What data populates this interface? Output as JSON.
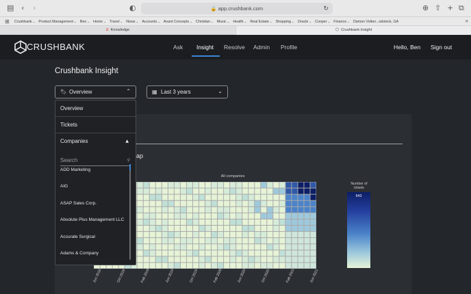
{
  "browser": {
    "url": "app.crushbank.com",
    "favorites": [
      {
        "label": "Crushbank",
        "dropdown": true
      },
      {
        "label": "Product Management",
        "dropdown": true
      },
      {
        "label": "Ben",
        "dropdown": true
      },
      {
        "label": "Home",
        "dropdown": true
      },
      {
        "label": "Travel",
        "dropdown": true
      },
      {
        "label": "News",
        "dropdown": true
      },
      {
        "label": "Accounts",
        "dropdown": true
      },
      {
        "label": "Avant Concepts",
        "dropdown": true
      },
      {
        "label": "Christian",
        "dropdown": true
      },
      {
        "label": "Music",
        "dropdown": true
      },
      {
        "label": "Health",
        "dropdown": true
      },
      {
        "label": "Real Estate",
        "dropdown": true
      },
      {
        "label": "Shopping",
        "dropdown": true
      },
      {
        "label": "Oracle",
        "dropdown": true
      },
      {
        "label": "Cooper",
        "dropdown": true
      },
      {
        "label": "Finance",
        "dropdown": true
      },
      {
        "label": "Damon Volker...odstock, GA",
        "dropdown": false
      }
    ],
    "tabs": [
      {
        "label": "Knowledge",
        "active": false
      },
      {
        "label": "Crushbank Insight",
        "active": true
      }
    ]
  },
  "app": {
    "logo_text": "CRUSHBANK",
    "nav": [
      "Ask",
      "Insight",
      "Resolve",
      "Admin",
      "Profile"
    ],
    "active_nav": "Insight",
    "greeting": "Hello, Ben",
    "signout": "Sign out"
  },
  "page": {
    "title": "Crushbank Insight",
    "view_select": "Overview",
    "range_select": "Last 3 years",
    "heading_fragment": "ap"
  },
  "dropdown": {
    "items": [
      "Overview",
      "Tickets",
      "Companies"
    ],
    "search_placeholder": "Search",
    "companies": [
      "ADD Marketing",
      "AIG",
      "ASAP Sales Corp.",
      "Absolute Plus Management LLC",
      "Accurate Surgical",
      "Adams & Company"
    ]
  },
  "chart_data": {
    "type": "heatmap",
    "title": "All companies",
    "legend_title": "Number of tickets",
    "legend_max": "643",
    "x_tick_labels": [
      "Jun 2018",
      "Oct 2018",
      "Feb 2019",
      "Jun 2019",
      "Oct 2019",
      "Feb 2020",
      "Jun 2020",
      "Oct 2020",
      "Feb 2021",
      "Jun 2021"
    ],
    "colors": {
      "low": "#e6f3d6",
      "mid": "#9ec9dc",
      "high": "#4b83c9",
      "max": "#0d1e66"
    }
  }
}
